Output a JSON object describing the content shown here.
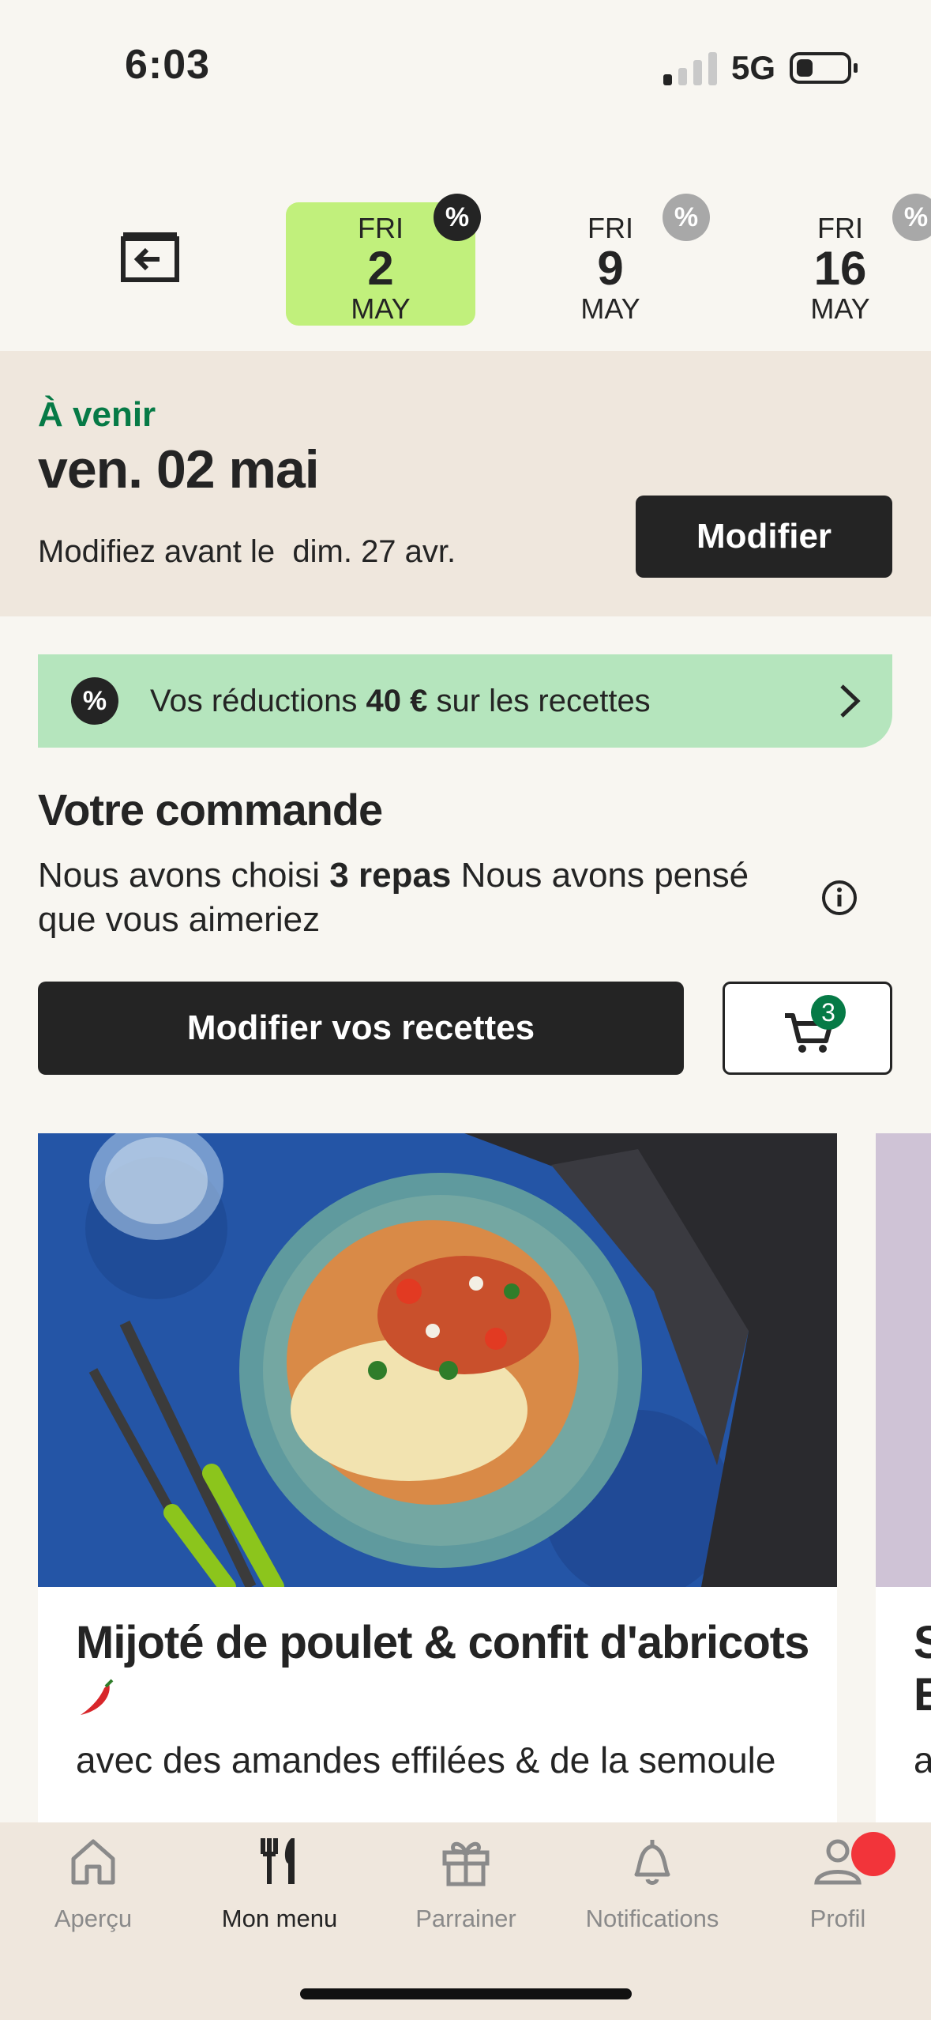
{
  "status_bar": {
    "time": "6:03",
    "network": "5G"
  },
  "date_tabs": [
    {
      "dow": "FRI",
      "day": "2",
      "month": "MAY",
      "active": true
    },
    {
      "dow": "FRI",
      "day": "9",
      "month": "MAY",
      "active": false
    },
    {
      "dow": "FRI",
      "day": "16",
      "month": "MAY",
      "active": false
    }
  ],
  "upcoming": {
    "label": "À venir",
    "date": "ven. 02 mai",
    "deadline": "Modifiez avant le  dim. 27 avr.",
    "modify_label": "Modifier"
  },
  "discount": {
    "prefix": "Vos réductions ",
    "amount": "40 €",
    "suffix": " sur les recettes"
  },
  "order": {
    "title": "Votre commande",
    "desc_prefix": "Nous avons choisi ",
    "desc_bold": "3 repas",
    "desc_suffix": " Nous avons pensé que vous aimeriez",
    "edit_label": "Modifier vos recettes",
    "cart_count": "3"
  },
  "recipes": [
    {
      "title": "Mijoté de poulet & confit d'abricots",
      "subtitle": "avec des amandes effilées & de la semoule"
    }
  ],
  "next_card_peek": {
    "title_letters": "S\nE",
    "sub_letter": "a"
  },
  "bottom_nav": [
    {
      "label": "Aperçu",
      "icon": "home-icon",
      "active": false
    },
    {
      "label": "Mon menu",
      "icon": "cutlery-icon",
      "active": true
    },
    {
      "label": "Parrainer",
      "icon": "gift-icon",
      "active": false
    },
    {
      "label": "Notifications",
      "icon": "bell-icon",
      "active": false
    },
    {
      "label": "Profil",
      "icon": "profile-icon",
      "active": false
    }
  ],
  "colors": {
    "accent_green": "#067a46",
    "active_tab": "#c1f07c",
    "discount_bg": "#b5e5bd",
    "section_bg": "#efe7dd",
    "notification_dot": "#f2343a"
  }
}
